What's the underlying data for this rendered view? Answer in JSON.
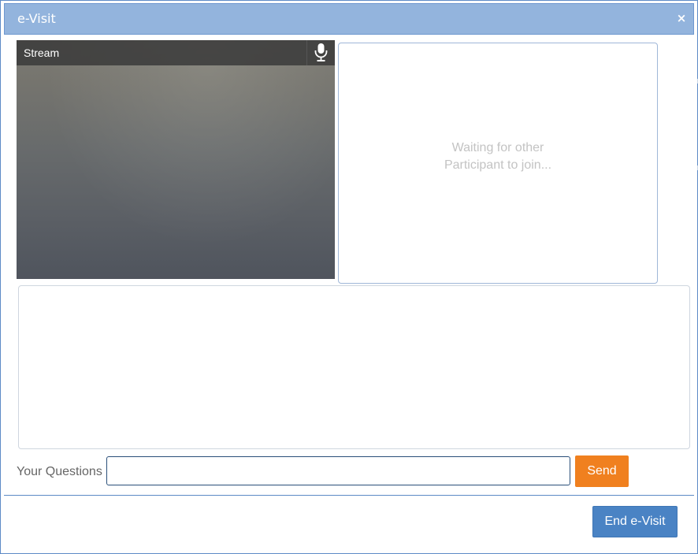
{
  "window": {
    "title": "e-Visit",
    "close_icon": "close-icon",
    "close_glyph": "×"
  },
  "local_video": {
    "label": "Stream",
    "mic_icon": "microphone-icon"
  },
  "remote_video": {
    "status_text": "Waiting for other\nParticipant to join..."
  },
  "chat": {
    "messages": []
  },
  "question": {
    "label": "Your Questions",
    "value": "",
    "placeholder": "",
    "send_label": "Send"
  },
  "footer": {
    "end_label": "End e-Visit"
  },
  "colors": {
    "title_bar": "#93b4dd",
    "send_button": "#f0801f",
    "end_button": "#4a83c4"
  }
}
